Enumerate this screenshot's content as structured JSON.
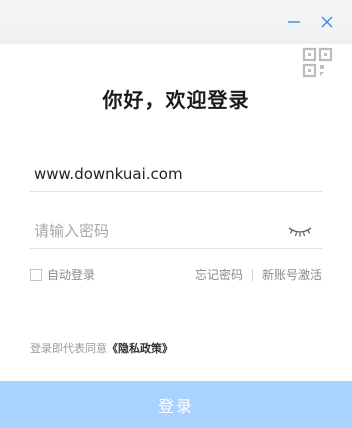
{
  "title": "你好，欢迎登录",
  "username": {
    "value": "www.downkuai.com"
  },
  "password": {
    "placeholder": "请输入密码"
  },
  "options": {
    "auto_login": "自动登录",
    "forgot_password": "忘记密码",
    "activate_account": "新账号激活"
  },
  "agreement": {
    "prefix": "登录即代表同意",
    "policy": "《隐私政策》"
  },
  "login_button": "登录",
  "icons": {
    "minimize": "minimize-icon",
    "close": "close-icon",
    "qr_code": "qr-code-icon",
    "password_toggle": "eye-closed-icon"
  },
  "colors": {
    "accent": "#2d8cf0",
    "button_disabled": "#a9d2ff"
  }
}
